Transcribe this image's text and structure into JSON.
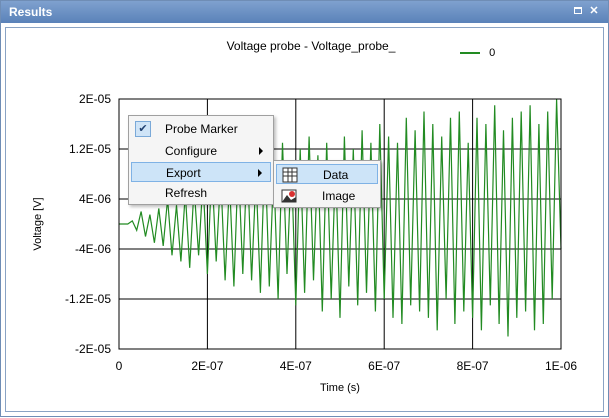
{
  "window": {
    "title": "Results"
  },
  "chart_data": {
    "type": "line",
    "title": "Voltage probe - Voltage_probe_",
    "xlabel": "Time (s)",
    "ylabel": "Voltage [V]",
    "xlim": [
      0,
      1e-06
    ],
    "ylim": [
      -2e-05,
      2e-05
    ],
    "x_ticks": [
      "0",
      "2E-07",
      "4E-07",
      "6E-07",
      "8E-07",
      "1E-06"
    ],
    "y_ticks": [
      "2E-05",
      "1.2E-05",
      "4E-06",
      "-4E-06",
      "-1.2E-05",
      "-2E-05"
    ],
    "grid": true,
    "legend_position": "top-right",
    "series": [
      {
        "name": "0",
        "color": "#228b22",
        "x": [
          0,
          1e-08,
          2e-08,
          3e-08,
          4e-08,
          5e-08,
          6e-08,
          7e-08,
          8e-08,
          9e-08,
          1e-07,
          1.1e-07,
          1.2e-07,
          1.3e-07,
          1.4e-07,
          1.5e-07,
          1.6e-07,
          1.7e-07,
          1.8e-07,
          1.9e-07,
          2e-07,
          2.1e-07,
          2.2e-07,
          2.3e-07,
          2.4e-07,
          2.5e-07,
          2.6e-07,
          2.7e-07,
          2.8e-07,
          2.9e-07,
          3e-07,
          3.1e-07,
          3.2e-07,
          3.3e-07,
          3.4e-07,
          3.5e-07,
          3.6e-07,
          3.7e-07,
          3.8e-07,
          3.9e-07,
          4e-07,
          4.1e-07,
          4.2e-07,
          4.3e-07,
          4.4e-07,
          4.5e-07,
          4.6e-07,
          4.7e-07,
          4.8e-07,
          4.9e-07,
          5e-07,
          5.1e-07,
          5.2e-07,
          5.3e-07,
          5.4e-07,
          5.5e-07,
          5.6e-07,
          5.7e-07,
          5.8e-07,
          5.9e-07,
          6e-07,
          6.1e-07,
          6.2e-07,
          6.3e-07,
          6.4e-07,
          6.5e-07,
          6.6e-07,
          6.7e-07,
          6.8e-07,
          6.9e-07,
          7e-07,
          7.1e-07,
          7.2e-07,
          7.3e-07,
          7.4e-07,
          7.5e-07,
          7.6e-07,
          7.7e-07,
          7.8e-07,
          7.9e-07,
          8e-07,
          8.1e-07,
          8.2e-07,
          8.3e-07,
          8.4e-07,
          8.5e-07,
          8.6e-07,
          8.7e-07,
          8.8e-07,
          8.9e-07,
          9e-07,
          9.1e-07,
          9.2e-07,
          9.3e-07,
          9.4e-07,
          9.5e-07,
          9.6e-07,
          9.7e-07,
          9.8e-07,
          9.9e-07,
          1e-06
        ],
        "y": [
          0,
          0,
          0,
          5e-07,
          -1e-06,
          2e-06,
          -2e-06,
          1.5e-06,
          -3e-06,
          2.5e-06,
          -3.5e-06,
          4e-06,
          -5e-06,
          3e-06,
          -6e-06,
          5e-06,
          -7e-06,
          6e-06,
          -5e-06,
          7e-06,
          -8e-06,
          9e-06,
          -6e-06,
          8e-06,
          -9e-06,
          7e-06,
          -1e-05,
          1e-05,
          -8e-06,
          1.1e-05,
          -9e-06,
          8e-06,
          -1.1e-05,
          1.2e-05,
          -1e-05,
          9e-06,
          -1.2e-05,
          1.3e-05,
          -8e-06,
          1e-05,
          -1.3e-05,
          1.2e-05,
          -1.1e-05,
          1.4e-05,
          -9e-06,
          1.1e-05,
          -1.4e-05,
          1.3e-05,
          -1.2e-05,
          1e-05,
          -1.5e-05,
          1.4e-05,
          -1e-05,
          1.2e-05,
          -1.3e-05,
          1.5e-05,
          -1.1e-05,
          1.3e-05,
          -1.4e-05,
          1.6e-05,
          -1.2e-05,
          1.4e-05,
          -1.5e-05,
          1.3e-05,
          -1.6e-05,
          1.7e-05,
          -1.3e-05,
          1.5e-05,
          -1.4e-05,
          1.8e-05,
          -1.5e-05,
          1.6e-05,
          -1.7e-05,
          1.4e-05,
          -1.2e-05,
          1.7e-05,
          -1.6e-05,
          1.8e-05,
          -1.4e-05,
          1.3e-05,
          -1.5e-05,
          1.7e-05,
          -1.7e-05,
          1.6e-05,
          -1.3e-05,
          1.9e-05,
          -1.6e-05,
          1.5e-05,
          -1.8e-05,
          1.7e-05,
          -1.5e-05,
          1.8e-05,
          -1.4e-05,
          1.9e-05,
          -1.7e-05,
          1.6e-05,
          -1.6e-05,
          1.8e-05,
          -1.2e-05,
          2e-05,
          -4e-06
        ]
      }
    ]
  },
  "context_menu": {
    "items": [
      {
        "label": "Probe Marker",
        "checked": true,
        "has_submenu": false
      },
      {
        "label": "Configure",
        "checked": false,
        "has_submenu": true
      },
      {
        "label": "Export",
        "checked": false,
        "has_submenu": true,
        "highlighted": true
      },
      {
        "label": "Refresh",
        "checked": false,
        "has_submenu": false
      }
    ],
    "submenu": [
      {
        "label": "Data",
        "icon": "data-table-icon",
        "highlighted": true
      },
      {
        "label": "Image",
        "icon": "image-icon",
        "highlighted": false
      }
    ]
  }
}
